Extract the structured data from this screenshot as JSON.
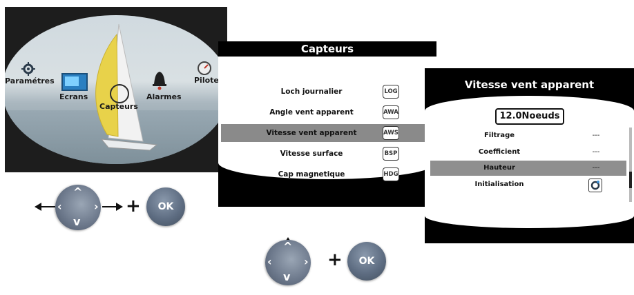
{
  "screen1": {
    "menu_items": [
      {
        "label": "Paramétres",
        "icon": "gear-icon"
      },
      {
        "label": "Ecrans",
        "icon": "screen-icon"
      },
      {
        "label": "Capteurs",
        "icon": "sensor-icon"
      },
      {
        "label": "Alarmes",
        "icon": "bell-icon"
      },
      {
        "label": "Pilote",
        "icon": "gauge-icon"
      }
    ]
  },
  "screen2": {
    "title": "Capteurs",
    "rows": [
      {
        "label": "Loch journalier",
        "badge": "LOG",
        "selected": false
      },
      {
        "label": "Angle vent apparent",
        "badge": "AWA",
        "selected": false
      },
      {
        "label": "Vitesse vent apparent",
        "badge": "AWS",
        "selected": true
      },
      {
        "label": "Vitesse surface",
        "badge": "BSP",
        "selected": false
      },
      {
        "label": "Cap magnetique",
        "badge": "HDG",
        "selected": false
      }
    ]
  },
  "screen3": {
    "title": "Vitesse vent apparent",
    "value": "12.0Noeuds",
    "rows": [
      {
        "label": "Filtrage",
        "value": "---",
        "selected": false
      },
      {
        "label": "Coefficient",
        "value": "---",
        "selected": false
      },
      {
        "label": "Hauteur",
        "value": "---",
        "selected": true
      },
      {
        "label": "Initialisation",
        "value": "",
        "selected": false
      }
    ]
  },
  "controls": {
    "ok_label": "OK",
    "plus": "+"
  },
  "colors": {
    "screen_bg": "#000000",
    "selection": "#8a8a8a",
    "button": "#5e6d82"
  }
}
